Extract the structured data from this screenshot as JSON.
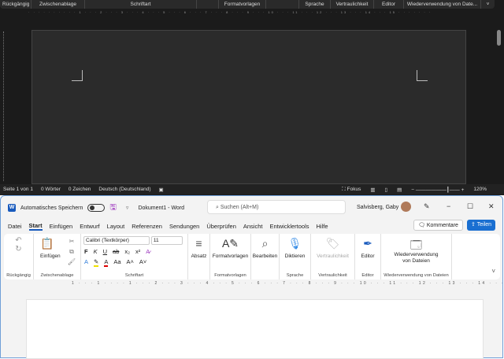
{
  "dark_window": {
    "groups": [
      "Rückgängig",
      "Zwischenablage",
      "Schriftart",
      "",
      "Formatvorlagen",
      "",
      "Sprache",
      "Vertraulichkeit",
      "Editor",
      "Wiederverwendung von Date..."
    ],
    "ruler": "· · · · · · · · · · 1 · · · 2 · · · 3 · · · 4 · · · 5 · · · 6 · · · 7 · · · 8 · · · 9 · · · 10 · · · 11 · · · 12 · · · 13 · · · 14 · · · 15 · · · · · · ·",
    "status": {
      "page": "Seite 1 von 1",
      "words": "0 Wörter",
      "chars": "0 Zeichen",
      "language": "Deutsch (Deutschland)",
      "focus": "Fokus",
      "zoom": "120%"
    }
  },
  "light_window": {
    "autosave_label": "Automatisches Speichern",
    "doc_title": "Dokument1 - Word",
    "search_placeholder": "Suchen (Alt+M)",
    "user": "Salvisberg, Gaby",
    "tabs": [
      "Datei",
      "Start",
      "Einfügen",
      "Entwurf",
      "Layout",
      "Referenzen",
      "Sendungen",
      "Überprüfen",
      "Ansicht",
      "Entwicklertools",
      "Hilfe"
    ],
    "comments_button": "Kommentare",
    "share_button": "Teilen",
    "ribbon": {
      "undo_group": "Rückgängig",
      "paste": "Einfügen",
      "clipboard_group": "Zwischenablage",
      "font_name": "Calibri (Textkörper)",
      "font_size": "11",
      "font_group": "Schriftart",
      "bold": "F",
      "italic": "K",
      "underline": "U",
      "strike": "ab",
      "sub": "x₂",
      "sup": "x²",
      "case": "Aa",
      "paragraph": "Absatz",
      "styles": "Formatvorlagen",
      "styles_group": "Formatvorlagen",
      "editing": "Bearbeiten",
      "dictate": "Diktieren",
      "voice_group": "Sprache",
      "sensitivity": "Vertraulichkeit",
      "sensitivity_group": "Vertraulichkeit",
      "editor": "Editor",
      "editor_group": "Editor",
      "reuse_line1": "Wiederverwendung",
      "reuse_line2": "von Dateien",
      "reuse_group": "Wiederverwendung von Dateien"
    },
    "ruler": "1 · · · 1 · · · · 1 · · · 2 · · · 3 · · · 4 · · · 5 · · · 6 · · · 7 · · · 8 · · · 9 · · · 10 · · · 11 · · · 12 · · · 13 · · · 14 · · · 15 · · · · ·"
  }
}
